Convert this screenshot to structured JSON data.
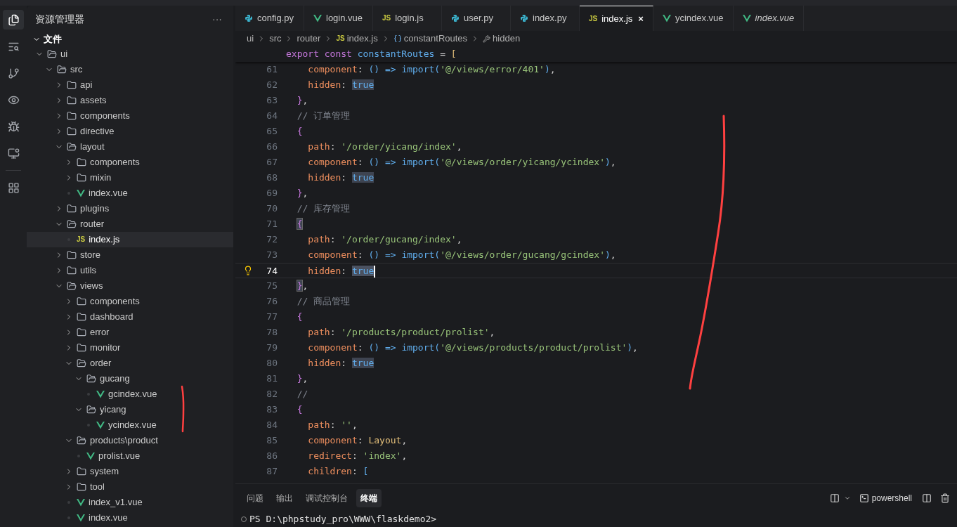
{
  "activity_bar": [
    {
      "kind": "files",
      "selected": true
    },
    {
      "kind": "search",
      "selected": false
    },
    {
      "kind": "git",
      "selected": false
    },
    {
      "kind": "eye",
      "selected": false
    },
    {
      "kind": "bug",
      "selected": false
    },
    {
      "kind": "remote",
      "selected": false
    },
    {
      "kind": "extensions",
      "selected": false
    }
  ],
  "explorer": {
    "title": "资源管理器",
    "more": "···",
    "section": {
      "label": "文件",
      "expanded": true
    },
    "tree": [
      {
        "name": "ui",
        "kind": "folder",
        "expanded": true,
        "selected": false,
        "children": [
          {
            "name": "src",
            "kind": "folder",
            "expanded": true,
            "selected": false,
            "children": [
              {
                "name": "api",
                "kind": "folder",
                "expanded": false,
                "selected": false
              },
              {
                "name": "assets",
                "kind": "folder",
                "expanded": false,
                "selected": false
              },
              {
                "name": "components",
                "kind": "folder",
                "expanded": false,
                "selected": false
              },
              {
                "name": "directive",
                "kind": "folder",
                "expanded": false,
                "selected": false
              },
              {
                "name": "layout",
                "kind": "folder",
                "expanded": true,
                "selected": false,
                "children": [
                  {
                    "name": "components",
                    "kind": "folder",
                    "expanded": false,
                    "selected": false
                  },
                  {
                    "name": "mixin",
                    "kind": "folder",
                    "expanded": false,
                    "selected": false
                  },
                  {
                    "name": "index.vue",
                    "kind": "vue",
                    "selected": false
                  }
                ]
              },
              {
                "name": "plugins",
                "kind": "folder",
                "expanded": false,
                "selected": false
              },
              {
                "name": "router",
                "kind": "folder",
                "expanded": true,
                "selected": false,
                "children": [
                  {
                    "name": "index.js",
                    "kind": "js",
                    "icon_text": "JS",
                    "selected": true
                  }
                ]
              },
              {
                "name": "store",
                "kind": "folder",
                "expanded": false,
                "selected": false
              },
              {
                "name": "utils",
                "kind": "folder",
                "expanded": false,
                "selected": false
              },
              {
                "name": "views",
                "kind": "folder",
                "expanded": true,
                "selected": false,
                "children": [
                  {
                    "name": "components",
                    "kind": "folder",
                    "expanded": false,
                    "selected": false
                  },
                  {
                    "name": "dashboard",
                    "kind": "folder",
                    "expanded": false,
                    "selected": false
                  },
                  {
                    "name": "error",
                    "kind": "folder",
                    "expanded": false,
                    "selected": false
                  },
                  {
                    "name": "monitor",
                    "kind": "folder",
                    "expanded": false,
                    "selected": false
                  },
                  {
                    "name": "order",
                    "kind": "folder",
                    "expanded": true,
                    "selected": false,
                    "children": [
                      {
                        "name": "gucang",
                        "kind": "folder",
                        "expanded": true,
                        "selected": false,
                        "children": [
                          {
                            "name": "gcindex.vue",
                            "kind": "vue",
                            "selected": false
                          }
                        ]
                      },
                      {
                        "name": "yicang",
                        "kind": "folder",
                        "expanded": true,
                        "selected": false,
                        "children": [
                          {
                            "name": "ycindex.vue",
                            "kind": "vue",
                            "selected": false
                          }
                        ]
                      }
                    ]
                  },
                  {
                    "name": "products\\product",
                    "kind": "folder",
                    "expanded": true,
                    "selected": false,
                    "children": [
                      {
                        "name": "prolist.vue",
                        "kind": "vue",
                        "selected": false
                      }
                    ]
                  },
                  {
                    "name": "system",
                    "kind": "folder",
                    "expanded": false,
                    "selected": false
                  },
                  {
                    "name": "tool",
                    "kind": "folder",
                    "expanded": false,
                    "selected": false
                  },
                  {
                    "name": "index_v1.vue",
                    "kind": "vue",
                    "selected": false
                  },
                  {
                    "name": "index.vue",
                    "kind": "vue",
                    "selected": false
                  }
                ]
              }
            ]
          }
        ]
      }
    ]
  },
  "tabs": [
    {
      "label": "config.py",
      "kind": "py",
      "selected": false,
      "preview": false
    },
    {
      "label": "login.vue",
      "kind": "vue",
      "selected": false,
      "preview": false
    },
    {
      "label": "login.js",
      "kind": "js",
      "icon_text": "JS",
      "selected": false,
      "preview": false
    },
    {
      "label": "user.py",
      "kind": "py",
      "selected": false,
      "preview": false
    },
    {
      "label": "index.py",
      "kind": "py",
      "selected": false,
      "preview": false
    },
    {
      "label": "index.js",
      "kind": "js",
      "icon_text": "JS",
      "selected": true,
      "preview": false,
      "close": "×"
    },
    {
      "label": "ycindex.vue",
      "kind": "vue",
      "selected": false,
      "preview": false
    },
    {
      "label": "index.vue",
      "kind": "vue",
      "selected": false,
      "preview": true
    }
  ],
  "breadcrumbs": [
    {
      "label": "ui",
      "kind": "folder"
    },
    {
      "label": "src",
      "kind": "folder"
    },
    {
      "label": "router",
      "kind": "folder"
    },
    {
      "label": "index.js",
      "kind": "js",
      "icon_text": "JS"
    },
    {
      "label": "constantRoutes",
      "kind": "variable"
    },
    {
      "label": "hidden",
      "kind": "property"
    }
  ],
  "sticky_line": [
    {
      "kind": "kw",
      "text": "export const "
    },
    {
      "kind": "var",
      "text": "constantRoutes"
    },
    {
      "kind": "plain",
      "text": " = "
    },
    {
      "kind": "bracket",
      "text": "["
    }
  ],
  "code": [
    {
      "n": "61",
      "current": false,
      "tokens": [
        {
          "kind": "prop",
          "text": "    component"
        },
        {
          "kind": "plain",
          "text": ": "
        },
        {
          "kind": "fn",
          "text": "() => import"
        },
        {
          "kind": "paren",
          "text": "("
        },
        {
          "kind": "str",
          "text": "'@/views/error/401'"
        },
        {
          "kind": "paren",
          "text": ")"
        },
        {
          "kind": "plain",
          "text": ","
        }
      ]
    },
    {
      "n": "62",
      "current": false,
      "tokens": [
        {
          "kind": "prop",
          "text": "    hidden"
        },
        {
          "kind": "plain",
          "text": ": "
        },
        {
          "kind": "match",
          "text": "true"
        }
      ]
    },
    {
      "n": "63",
      "current": false,
      "tokens": [
        {
          "kind": "brace",
          "text": "  }"
        },
        {
          "kind": "plain",
          "text": ","
        }
      ]
    },
    {
      "n": "64",
      "current": false,
      "tokens": [
        {
          "kind": "comment",
          "text": "  // 订单管理"
        }
      ]
    },
    {
      "n": "65",
      "current": false,
      "tokens": [
        {
          "kind": "brace",
          "text": "  {"
        }
      ]
    },
    {
      "n": "66",
      "current": false,
      "tokens": [
        {
          "kind": "prop",
          "text": "    path"
        },
        {
          "kind": "plain",
          "text": ": "
        },
        {
          "kind": "str",
          "text": "'/order/yicang/index'"
        },
        {
          "kind": "plain",
          "text": ","
        }
      ]
    },
    {
      "n": "67",
      "current": false,
      "tokens": [
        {
          "kind": "prop",
          "text": "    component"
        },
        {
          "kind": "plain",
          "text": ": "
        },
        {
          "kind": "fn",
          "text": "() => import"
        },
        {
          "kind": "paren",
          "text": "("
        },
        {
          "kind": "str",
          "text": "'@/views/order/yicang/ycindex'"
        },
        {
          "kind": "paren",
          "text": ")"
        },
        {
          "kind": "plain",
          "text": ","
        }
      ]
    },
    {
      "n": "68",
      "current": false,
      "tokens": [
        {
          "kind": "prop",
          "text": "    hidden"
        },
        {
          "kind": "plain",
          "text": ": "
        },
        {
          "kind": "match",
          "text": "true"
        }
      ]
    },
    {
      "n": "69",
      "current": false,
      "tokens": [
        {
          "kind": "brace",
          "text": "  }"
        },
        {
          "kind": "plain",
          "text": ","
        }
      ]
    },
    {
      "n": "70",
      "current": false,
      "tokens": [
        {
          "kind": "comment",
          "text": "  // 库存管理"
        }
      ]
    },
    {
      "n": "71",
      "current": false,
      "tokens": [
        {
          "kind": "brace_match",
          "text": "  {"
        }
      ]
    },
    {
      "n": "72",
      "current": false,
      "tokens": [
        {
          "kind": "prop",
          "text": "    path"
        },
        {
          "kind": "plain",
          "text": ": "
        },
        {
          "kind": "str",
          "text": "'/order/gucang/index'"
        },
        {
          "kind": "plain",
          "text": ","
        }
      ]
    },
    {
      "n": "73",
      "current": false,
      "tokens": [
        {
          "kind": "prop",
          "text": "    component"
        },
        {
          "kind": "plain",
          "text": ": "
        },
        {
          "kind": "fn",
          "text": "() => import"
        },
        {
          "kind": "paren",
          "text": "("
        },
        {
          "kind": "str",
          "text": "'@/views/order/gucang/gcindex'"
        },
        {
          "kind": "paren",
          "text": ")"
        },
        {
          "kind": "plain",
          "text": ","
        }
      ]
    },
    {
      "n": "74",
      "current": true,
      "tokens": [
        {
          "kind": "prop",
          "text": "    hidden"
        },
        {
          "kind": "plain",
          "text": ": "
        },
        {
          "kind": "selected",
          "text": "true"
        }
      ]
    },
    {
      "n": "75",
      "current": false,
      "tokens": [
        {
          "kind": "brace_match",
          "text": "  }"
        },
        {
          "kind": "plain",
          "text": ","
        }
      ]
    },
    {
      "n": "76",
      "current": false,
      "tokens": [
        {
          "kind": "comment",
          "text": "  // 商品管理"
        }
      ]
    },
    {
      "n": "77",
      "current": false,
      "tokens": [
        {
          "kind": "brace",
          "text": "  {"
        }
      ]
    },
    {
      "n": "78",
      "current": false,
      "tokens": [
        {
          "kind": "prop",
          "text": "    path"
        },
        {
          "kind": "plain",
          "text": ": "
        },
        {
          "kind": "str",
          "text": "'/products/product/prolist'"
        },
        {
          "kind": "plain",
          "text": ","
        }
      ]
    },
    {
      "n": "79",
      "current": false,
      "tokens": [
        {
          "kind": "prop",
          "text": "    component"
        },
        {
          "kind": "plain",
          "text": ": "
        },
        {
          "kind": "fn",
          "text": "() => import"
        },
        {
          "kind": "paren",
          "text": "("
        },
        {
          "kind": "str",
          "text": "'@/views/products/product/prolist'"
        },
        {
          "kind": "paren",
          "text": ")"
        },
        {
          "kind": "plain",
          "text": ","
        }
      ]
    },
    {
      "n": "80",
      "current": false,
      "tokens": [
        {
          "kind": "prop",
          "text": "    hidden"
        },
        {
          "kind": "plain",
          "text": ": "
        },
        {
          "kind": "match",
          "text": "true"
        }
      ]
    },
    {
      "n": "81",
      "current": false,
      "tokens": [
        {
          "kind": "brace",
          "text": "  }"
        },
        {
          "kind": "plain",
          "text": ","
        }
      ]
    },
    {
      "n": "82",
      "current": false,
      "tokens": [
        {
          "kind": "comment",
          "text": "  //"
        }
      ]
    },
    {
      "n": "83",
      "current": false,
      "tokens": [
        {
          "kind": "brace",
          "text": "  {"
        }
      ]
    },
    {
      "n": "84",
      "current": false,
      "tokens": [
        {
          "kind": "prop",
          "text": "    path"
        },
        {
          "kind": "plain",
          "text": ": "
        },
        {
          "kind": "str",
          "text": "''"
        },
        {
          "kind": "plain",
          "text": ","
        }
      ]
    },
    {
      "n": "85",
      "current": false,
      "tokens": [
        {
          "kind": "prop",
          "text": "    component"
        },
        {
          "kind": "plain",
          "text": ": "
        },
        {
          "kind": "type",
          "text": "Layout"
        },
        {
          "kind": "plain",
          "text": ","
        }
      ]
    },
    {
      "n": "86",
      "current": false,
      "tokens": [
        {
          "kind": "prop",
          "text": "    redirect"
        },
        {
          "kind": "plain",
          "text": ": "
        },
        {
          "kind": "str",
          "text": "'index'"
        },
        {
          "kind": "plain",
          "text": ","
        }
      ]
    },
    {
      "n": "87",
      "current": false,
      "tokens": [
        {
          "kind": "prop",
          "text": "    children"
        },
        {
          "kind": "plain",
          "text": ": "
        },
        {
          "kind": "paren",
          "text": "["
        }
      ]
    }
  ],
  "panel": {
    "tabs": [
      {
        "label": "问题",
        "selected": false
      },
      {
        "label": "输出",
        "selected": false
      },
      {
        "label": "调试控制台",
        "selected": false
      },
      {
        "label": "终端",
        "selected": true
      }
    ],
    "terminal_name": "powershell",
    "prompt": "PS D:\\phpstudy_pro\\WWW\\flaskdemo2>"
  }
}
